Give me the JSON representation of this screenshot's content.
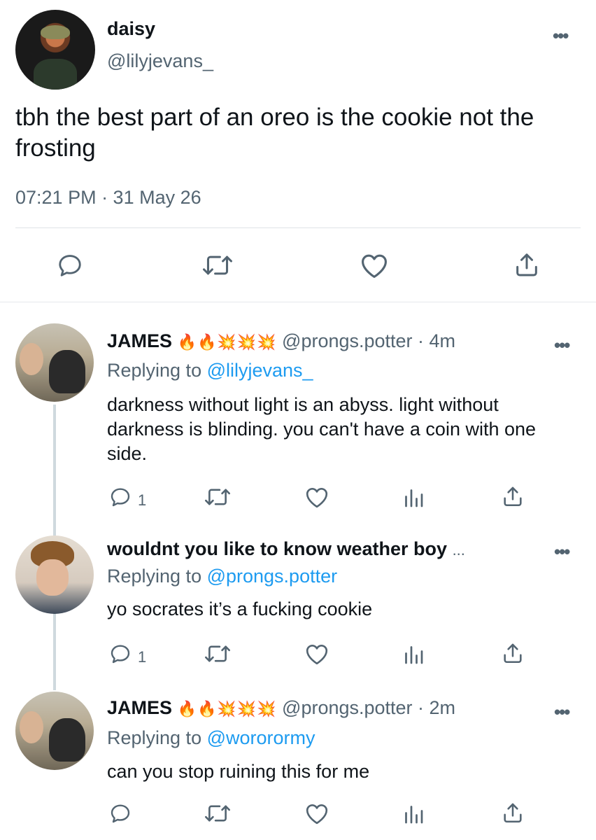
{
  "main_tweet": {
    "display_name": "daisy",
    "handle": "@lilyjevans_",
    "text": "tbh the best part of an oreo is the cookie not the frosting",
    "timestamp": "07:21 PM · 31 May 26",
    "more_label": "•••",
    "actions": [
      "reply-icon",
      "retweet-icon",
      "like-icon",
      "share-icon"
    ]
  },
  "replies": [
    {
      "display_name": "JAMES",
      "emojis": "🔥🔥💥💥💥",
      "handle_time": "@prongs.potter · 4m",
      "replying_prefix": "Replying to ",
      "replying_to": "@lilyjevans_",
      "text": "darkness without light is an abyss. light without darkness is blinding. you can't have a coin with one side.",
      "reply_count": "1",
      "more_label": "•••"
    },
    {
      "display_name": "wouldnt you like to know weather boy",
      "name_suffix": "...",
      "replying_prefix": "Replying to ",
      "replying_to": "@prongs.potter",
      "text": "yo socrates it’s a fucking cookie",
      "reply_count": "1",
      "more_label": "•••"
    },
    {
      "display_name": "JAMES",
      "emojis": "🔥🔥💥💥💥",
      "handle_time": "@prongs.potter · 2m",
      "replying_prefix": "Replying to ",
      "replying_to": "@wororormy",
      "text": "can you stop ruining this for me",
      "reply_count": "",
      "more_label": "•••"
    }
  ],
  "colors": {
    "text": "#0f1419",
    "secondary": "#536471",
    "link": "#1d9bf0",
    "thread_line": "#cfd9de"
  }
}
